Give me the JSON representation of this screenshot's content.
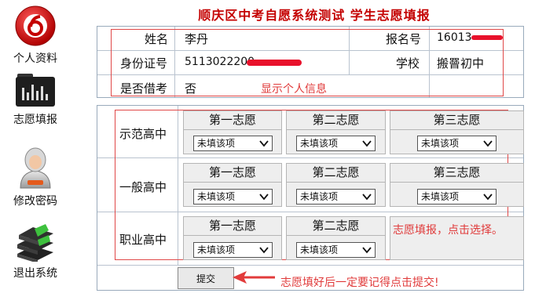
{
  "title": "顺庆区中考自愿系统测试  学生志愿填报",
  "sidebar": {
    "items": [
      {
        "label": "个人资料",
        "icon": "profile-icon"
      },
      {
        "label": "志愿填报",
        "icon": "equalizer-folder-icon"
      },
      {
        "label": "修改密码",
        "icon": "user-avatar-icon"
      },
      {
        "label": "退出系统",
        "icon": "books-exit-icon"
      }
    ]
  },
  "info": {
    "name_label": "姓名",
    "name_value": "李丹",
    "regno_label": "报名号",
    "regno_value": "16013",
    "id_label": "身份证号",
    "id_value": "5113022200",
    "school_label": "学校",
    "school_value": "搬罾初中",
    "repeat_label": "是否借考",
    "repeat_value": "否",
    "annotation": "显示个人信息"
  },
  "choices": {
    "rows": [
      {
        "label": "示范高中",
        "heads": [
          "第一志愿",
          "第二志愿",
          "第三志愿"
        ],
        "selects": [
          "未填该项",
          "未填该项",
          "未填该项"
        ]
      },
      {
        "label": "一般高中",
        "heads": [
          "第一志愿",
          "第二志愿",
          "第三志愿"
        ],
        "selects": [
          "未填该项",
          "未填该项",
          "未填该项"
        ]
      },
      {
        "label": "职业高中",
        "heads": [
          "第一志愿",
          "第二志愿"
        ],
        "selects": [
          "未填该项",
          "未填该项"
        ]
      }
    ],
    "annotation": "志愿填报，点击选择。"
  },
  "submit_label": "提交",
  "submit_annotation": "志愿填好后一定要记得点击提交!",
  "colors": {
    "title": "#c40000",
    "annotation": "#e03a3a",
    "border": "#9ab"
  }
}
